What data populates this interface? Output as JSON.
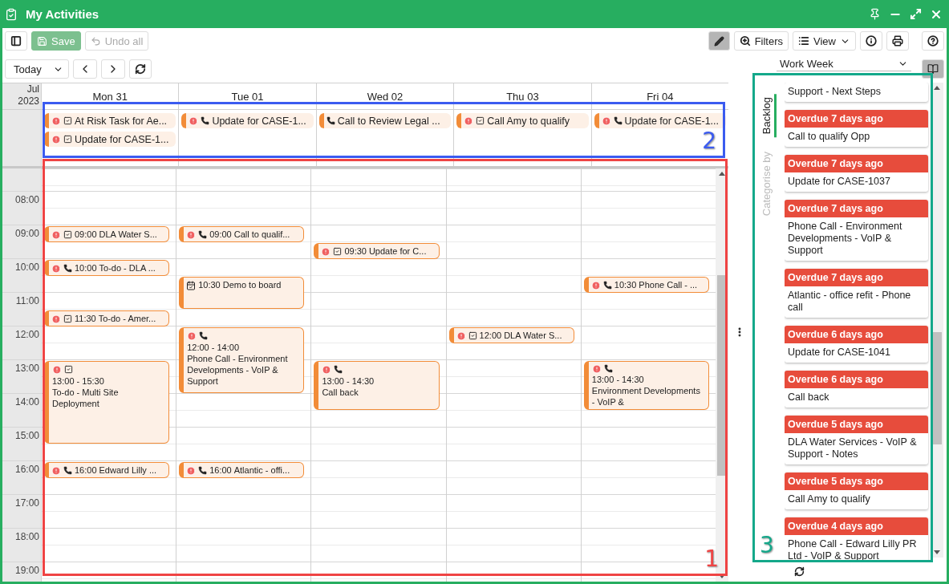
{
  "window": {
    "title": "My Activities"
  },
  "toolbar": {
    "save": "Save",
    "undo": "Undo all",
    "edit_active": true,
    "filters": "Filters",
    "view": "View"
  },
  "nav": {
    "today": "Today",
    "view_mode": "Work Week",
    "backlog_active": true
  },
  "calendar": {
    "month": "Jul",
    "year": "2023",
    "days": [
      {
        "label": "Mon 31",
        "all_day": [
          {
            "kind": "task",
            "alert": true,
            "title": "At Risk Task for Ae..."
          },
          {
            "kind": "task",
            "alert": true,
            "title": "Update for CASE-1..."
          }
        ],
        "events": [
          {
            "kind": "task",
            "alert": true,
            "time": "09:00",
            "title": "DLA Water S..."
          },
          {
            "kind": "call",
            "alert": true,
            "time": "10:00",
            "title": "To-do - DLA ..."
          },
          {
            "kind": "task",
            "alert": true,
            "time": "11:30",
            "title": "To-do - Amer..."
          },
          {
            "kind": "task",
            "alert": true,
            "time": "13:00 - 15:30",
            "title": "To-do - Multi Site Deployment"
          },
          {
            "kind": "call",
            "alert": true,
            "time": "16:00",
            "title": "Edward Lilly ..."
          }
        ]
      },
      {
        "label": "Tue 01",
        "all_day": [
          {
            "kind": "call",
            "alert": true,
            "title": "Update for CASE-1..."
          }
        ],
        "events": [
          {
            "kind": "call",
            "alert": true,
            "time": "09:00",
            "title": "Call to qualif..."
          },
          {
            "kind": "meeting",
            "alert": false,
            "time": "10:30",
            "title": "Demo to board"
          },
          {
            "kind": "call",
            "alert": true,
            "time": "12:00 - 14:00",
            "title": "Phone Call - Environment Developments - VoIP & Support"
          },
          {
            "kind": "call",
            "alert": true,
            "time": "16:00",
            "title": "Atlantic - offi..."
          }
        ]
      },
      {
        "label": "Wed 02",
        "all_day": [
          {
            "kind": "call",
            "alert": false,
            "title": "Call to Review Legal ..."
          }
        ],
        "events": [
          {
            "kind": "task",
            "alert": true,
            "time": "09:30",
            "title": "Update for C..."
          },
          {
            "kind": "call",
            "alert": true,
            "time": "13:00 - 14:30",
            "title": "Call back"
          }
        ]
      },
      {
        "label": "Thu 03",
        "all_day": [
          {
            "kind": "task",
            "alert": true,
            "title": "Call Amy to qualify"
          }
        ],
        "events": [
          {
            "kind": "task",
            "alert": true,
            "time": "12:00",
            "title": "DLA Water S..."
          }
        ]
      },
      {
        "label": "Fri 04",
        "all_day": [
          {
            "kind": "call",
            "alert": true,
            "title": "Update for CASE-1..."
          }
        ],
        "events": [
          {
            "kind": "call",
            "alert": true,
            "time": "10:30",
            "title": "Phone Call - ..."
          },
          {
            "kind": "call",
            "alert": true,
            "time": "13:00 - 14:30",
            "title": "Environment Developments - VoIP &"
          }
        ]
      }
    ],
    "hours": [
      "08:00",
      "09:00",
      "10:00",
      "11:00",
      "12:00",
      "13:00",
      "14:00",
      "15:00",
      "16:00",
      "17:00",
      "18:00",
      "19:00"
    ]
  },
  "side_tabs": [
    {
      "label": "Backlog",
      "selected": true
    },
    {
      "label": "Categorise by",
      "selected": false
    }
  ],
  "backlog": [
    {
      "kind": "partial",
      "title": "Support - Next Steps"
    },
    {
      "kind": "card",
      "status": "Overdue 7 days ago",
      "title": "Call to qualify Opp"
    },
    {
      "kind": "card",
      "status": "Overdue 7 days ago",
      "title": "Update for CASE-1037"
    },
    {
      "kind": "card",
      "status": "Overdue 7 days ago",
      "title": "Phone Call - Environment Developments - VoIP & Support"
    },
    {
      "kind": "card",
      "status": "Overdue 7 days ago",
      "title": "Atlantic - office refit - Phone call"
    },
    {
      "kind": "card",
      "status": "Overdue 6 days ago",
      "title": "Update for CASE-1041"
    },
    {
      "kind": "card",
      "status": "Overdue 6 days ago",
      "title": "Call back"
    },
    {
      "kind": "card",
      "status": "Overdue 5 days ago",
      "title": "DLA Water Services - VoIP & Support - Notes"
    },
    {
      "kind": "card",
      "status": "Overdue 5 days ago",
      "title": "Call Amy to qualify"
    },
    {
      "kind": "card",
      "status": "Overdue 4 days ago",
      "title": "Phone Call - Edward Lilly PR Ltd - VoIP & Support"
    }
  ],
  "callouts": [
    {
      "label": "1",
      "color": "#ef4444"
    },
    {
      "label": "2",
      "color": "#3b5bf0"
    },
    {
      "label": "3",
      "color": "#14a88a"
    }
  ]
}
